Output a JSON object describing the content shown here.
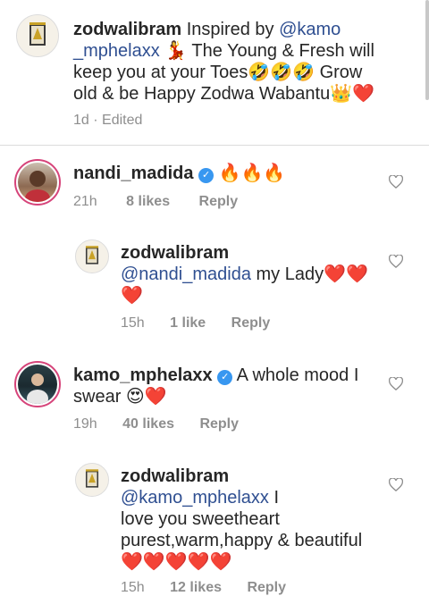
{
  "post": {
    "username": "zodwalibram",
    "caption_start": "Inspired by ",
    "mention": "@kamo",
    "line2_mention": "_mphelaxx",
    "line2_text": " The Young & Fresh will",
    "line3": "keep you at your Toes",
    "line3_end": " Grow",
    "line4": "old & be Happy Zodwa Wabantu",
    "time": "1d",
    "edited": "Edited"
  },
  "comments": [
    {
      "username": "nandi_madida",
      "text": "",
      "time": "21h",
      "likes": "8 likes",
      "reply": "Reply"
    },
    {
      "username": "zodwalibram",
      "mention": "@nandi_madida",
      "text": " my Lady",
      "time": "15h",
      "likes": "1 like",
      "reply": "Reply"
    },
    {
      "username": "kamo_mphelaxx",
      "text": "A whole mood I",
      "text2": "swear",
      "time": "19h",
      "likes": "40 likes",
      "reply": "Reply"
    },
    {
      "username": "zodwalibram",
      "mention": "@kamo_mphelaxx",
      "text": " I",
      "line2": "love you sweetheart",
      "line3": "purest,warm,happy & beautiful",
      "time": "15h",
      "likes": "12 likes",
      "reply": "Reply"
    }
  ],
  "emoji": {
    "dancer": "💃",
    "laughing": "🤣",
    "crown": "👑",
    "heart": "❤️",
    "fire": "🔥",
    "heart_eyes": "😍"
  },
  "colors": {
    "mention": "#2f4f91",
    "meta": "#8e8e8e",
    "verified": "#3897f0",
    "story_ring": "#d6447a"
  }
}
